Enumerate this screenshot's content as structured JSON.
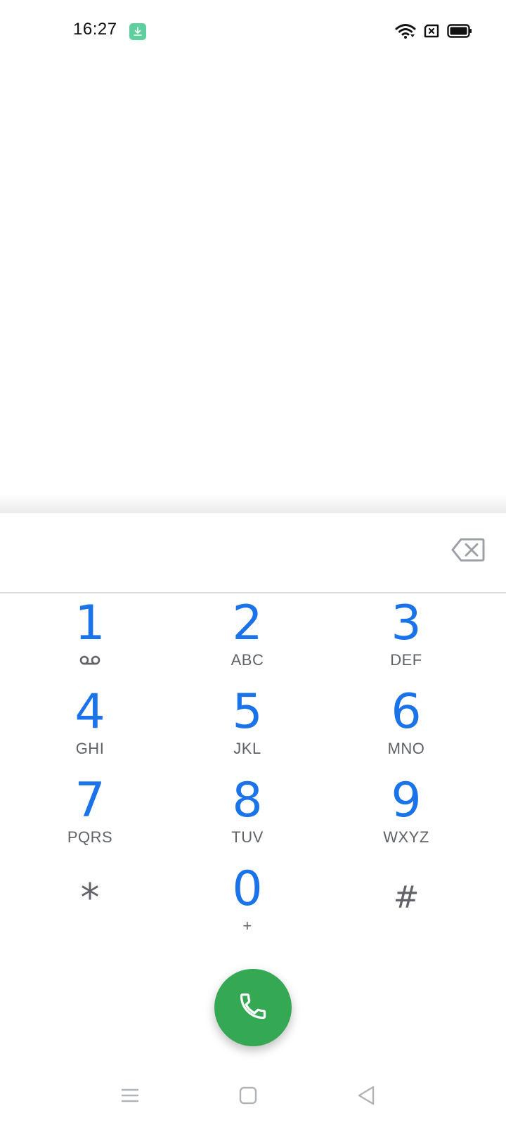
{
  "status_bar": {
    "time": "16:27",
    "icons": [
      "download-notification-icon",
      "wifi-icon",
      "no-sim-icon",
      "battery-icon"
    ]
  },
  "dialer": {
    "number_value": "",
    "backspace_icon": "backspace-icon",
    "keys": [
      {
        "digit": "1",
        "letters": "",
        "sub_icon": "voicemail-icon"
      },
      {
        "digit": "2",
        "letters": "ABC"
      },
      {
        "digit": "3",
        "letters": "DEF"
      },
      {
        "digit": "4",
        "letters": "GHI"
      },
      {
        "digit": "5",
        "letters": "JKL"
      },
      {
        "digit": "6",
        "letters": "MNO"
      },
      {
        "digit": "7",
        "letters": "PQRS"
      },
      {
        "digit": "8",
        "letters": "TUV"
      },
      {
        "digit": "9",
        "letters": "WXYZ"
      },
      {
        "digit": "*",
        "letters": ""
      },
      {
        "digit": "0",
        "letters": "+"
      },
      {
        "digit": "#",
        "letters": ""
      }
    ],
    "call_icon": "phone-icon"
  },
  "nav_bar": {
    "icons": [
      "menu-icon",
      "home-icon",
      "back-icon"
    ]
  },
  "colors": {
    "digit": "#1a73e8",
    "letters": "#5f6368",
    "call_button": "#34a853",
    "status_badge": "#5fcf9d"
  }
}
